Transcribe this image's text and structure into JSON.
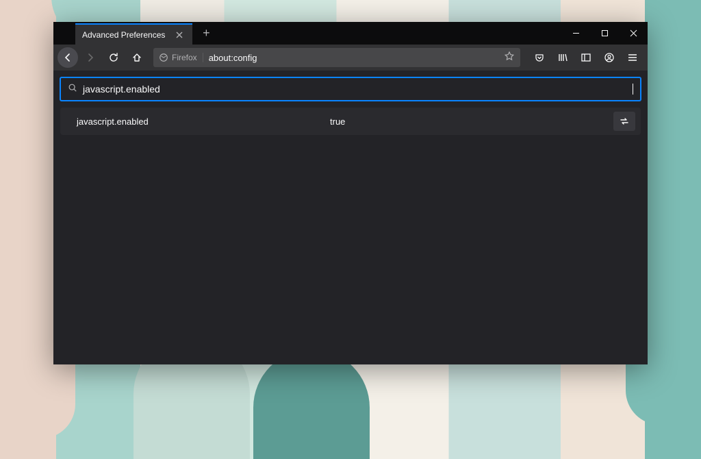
{
  "tab": {
    "title": "Advanced Preferences"
  },
  "url_bar": {
    "identity": "Firefox",
    "url": "about:config"
  },
  "search": {
    "value": "javascript.enabled"
  },
  "result": {
    "name": "javascript.enabled",
    "value": "true"
  }
}
